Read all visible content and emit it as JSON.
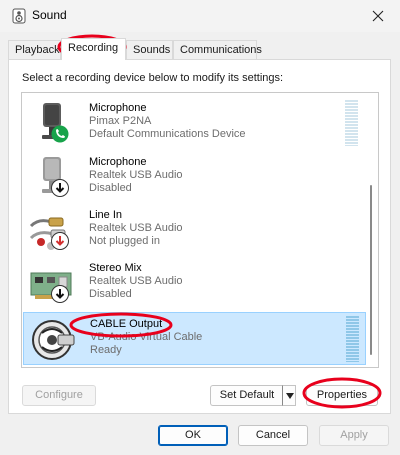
{
  "window": {
    "title": "Sound",
    "icon": "speaker-icon"
  },
  "tabs": [
    {
      "label": "Playback",
      "active": false
    },
    {
      "label": "Recording",
      "active": true
    },
    {
      "label": "Sounds",
      "active": false
    },
    {
      "label": "Communications",
      "active": false
    }
  ],
  "instruction": "Select a recording device below to modify its settings:",
  "devices": [
    {
      "name": "Microphone",
      "driver": "Pimax P2NA",
      "status": "Default Communications Device",
      "icon": "microphone-icon",
      "badge": "phone-badge-icon",
      "selected": false
    },
    {
      "name": "Microphone",
      "driver": "Realtek USB Audio",
      "status": "Disabled",
      "icon": "microphone-icon",
      "badge": "down-arrow-badge-icon",
      "selected": false
    },
    {
      "name": "Line In",
      "driver": "Realtek USB Audio",
      "status": "Not plugged in",
      "icon": "line-in-jack-icon",
      "badge": "red-down-arrow-badge-icon",
      "selected": false
    },
    {
      "name": "Stereo Mix",
      "driver": "Realtek USB Audio",
      "status": "Disabled",
      "icon": "sound-card-icon",
      "badge": "down-arrow-badge-icon",
      "selected": false
    },
    {
      "name": "CABLE Output",
      "driver": "VB-Audio Virtual Cable",
      "status": "Ready",
      "icon": "virtual-cable-icon",
      "badge": "",
      "selected": true
    }
  ],
  "buttons": {
    "configure": "Configure",
    "set_default": "Set Default",
    "properties": "Properties",
    "ok": "OK",
    "cancel": "Cancel",
    "apply": "Apply"
  },
  "colors": {
    "selection": "#cce8ff",
    "accent": "#005fb8",
    "annotation": "#e8001c",
    "phone_badge": "#18a34a"
  }
}
